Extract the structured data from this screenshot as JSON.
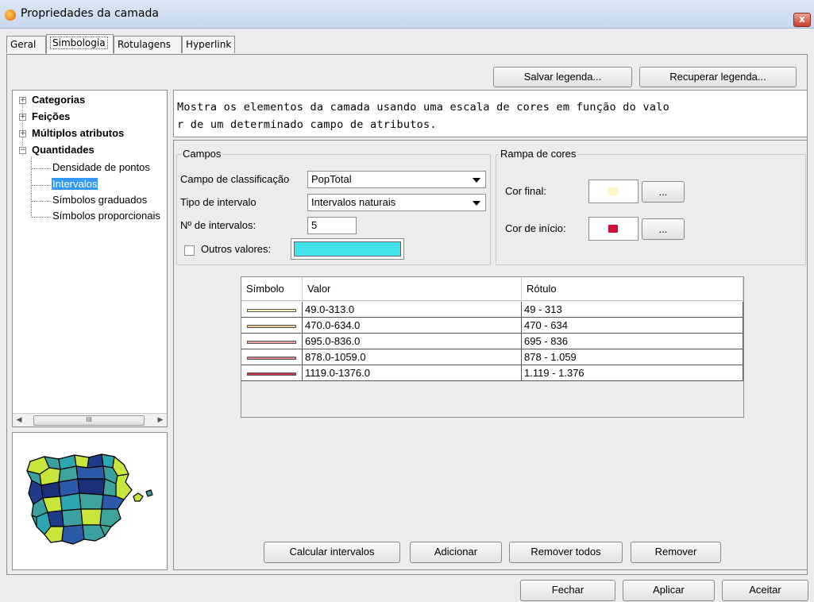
{
  "window": {
    "title": "Propriedades da camada",
    "close_label": "x"
  },
  "tabs": [
    {
      "label": "Geral",
      "active": false
    },
    {
      "label": "Simbologia",
      "active": true
    },
    {
      "label": "Rotulagens",
      "active": false
    },
    {
      "label": "Hyperlink",
      "active": false
    }
  ],
  "legend_buttons": {
    "save": "Salvar legenda...",
    "load": "Recuperar legenda..."
  },
  "tree": {
    "items": [
      {
        "label": "Categorias",
        "expander": "+"
      },
      {
        "label": "Feições",
        "expander": "+"
      },
      {
        "label": "Múltiplos atributos",
        "expander": "+"
      },
      {
        "label": "Quantidades",
        "expander": "−"
      }
    ],
    "children": [
      {
        "label": "Densidade de pontos"
      },
      {
        "label": "Intervalos",
        "selected": true
      },
      {
        "label": "Símbolos graduados"
      },
      {
        "label": "Símbolos proporcionais"
      }
    ],
    "scroll_thumb": "III"
  },
  "description": {
    "line1": "Mostra os elementos da camada usando uma escala de cores em função do valo",
    "line2": "r de um determinado campo de atributos."
  },
  "campos": {
    "title": "Campos",
    "classification_label": "Campo de classificação",
    "classification_value": "PopTotal",
    "interval_type_label": "Tipo de intervalo",
    "interval_type_value": "Intervalos naturais",
    "num_intervals_label": "Nº de intervalos:",
    "num_intervals_value": "5",
    "other_values_label": "Outros valores:",
    "other_values_color": "#42e3e8"
  },
  "ramp": {
    "title": "Rampa de cores",
    "end_label": "Cor final:",
    "end_color": "#fff7c8",
    "start_label": "Cor de início:",
    "start_color": "#d0103c",
    "picker_label": "..."
  },
  "table": {
    "headers": [
      "Símbolo",
      "Valor",
      "Rótulo"
    ],
    "rows": [
      {
        "value": "49.0-313.0",
        "label": "49 - 313",
        "color": "#f7f0bf"
      },
      {
        "value": "470.0-634.0",
        "label": "470 - 634",
        "color": "#eec7a0"
      },
      {
        "value": "695.0-836.0",
        "label": "695 - 836",
        "color": "#e4a4a4"
      },
      {
        "value": "878.0-1059.0",
        "label": "878 - 1.059",
        "color": "#d98088"
      },
      {
        "value": "1119.0-1376.0",
        "label": "1.119 - 1.376",
        "color": "#c8354e"
      }
    ]
  },
  "action_buttons": {
    "calculate": "Calcular intervalos",
    "add": "Adicionar",
    "remove_all": "Remover todos",
    "remove": "Remover"
  },
  "footer_buttons": {
    "close": "Fechar",
    "apply": "Aplicar",
    "accept": "Aceitar"
  }
}
